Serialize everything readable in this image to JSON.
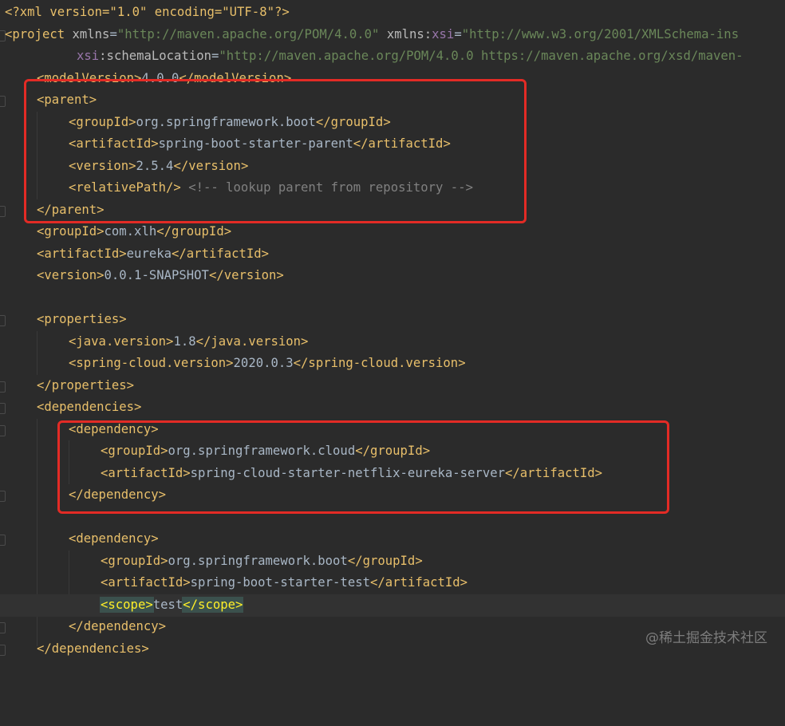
{
  "colors": {
    "background": "#2b2b2b",
    "tag": "#e8bf6a",
    "attribute": "#bababa",
    "namespace": "#9876aa",
    "string": "#6a8759",
    "text": "#a9b7c6",
    "comment": "#808080",
    "highlight_box": "#e32b25"
  },
  "lines": {
    "l1": {
      "decl": "<?xml version=\"1.0\" encoding=\"UTF-8\"?>"
    },
    "l2": {
      "open": "<project",
      "a1": " xmlns",
      "eq1": "=",
      "v1": "\"http://maven.apache.org/POM/4.0.0\"",
      "a2": " xmlns:",
      "ns2": "xsi",
      "eq2": "=",
      "v2": "\"http://www.w3.org/2001/XMLSchema-ins"
    },
    "l3": {
      "ns": "xsi",
      "a": ":schemaLocation",
      "eq": "=",
      "v": "\"http://maven.apache.org/POM/4.0.0 https://maven.apache.org/xsd/maven-"
    },
    "l4": {
      "open": "<modelVersion>",
      "text": "4.0.0",
      "close": "</modelVersion>"
    },
    "l5": {
      "open": "<parent>"
    },
    "l6": {
      "open": "<groupId>",
      "text": "org.springframework.boot",
      "close": "</groupId>"
    },
    "l7": {
      "open": "<artifactId>",
      "text": "spring-boot-starter-parent",
      "close": "</artifactId>"
    },
    "l8": {
      "open": "<version>",
      "text": "2.5.4",
      "close": "</version>"
    },
    "l9": {
      "open": "<relativePath/>",
      "comment": " <!-- lookup parent from repository -->"
    },
    "l10": {
      "close": "</parent>"
    },
    "l11": {
      "open": "<groupId>",
      "text": "com.xlh",
      "close": "</groupId>"
    },
    "l12": {
      "open": "<artifactId>",
      "text": "eureka",
      "close": "</artifactId>"
    },
    "l13": {
      "open": "<version>",
      "text": "0.0.1-SNAPSHOT",
      "close": "</version>"
    },
    "l15": {
      "open": "<properties>"
    },
    "l16": {
      "open": "<java.version>",
      "text": "1.8",
      "close": "</java.version>"
    },
    "l17": {
      "open": "<spring-cloud.version>",
      "text": "2020.0.3",
      "close": "</spring-cloud.version>"
    },
    "l18": {
      "close": "</properties>"
    },
    "l19": {
      "open": "<dependencies>"
    },
    "l20": {
      "open": "<dependency>"
    },
    "l21": {
      "open": "<groupId>",
      "text": "org.springframework.cloud",
      "close": "</groupId>"
    },
    "l22": {
      "open": "<artifactId>",
      "text": "spring-cloud-starter-netflix-eureka-server",
      "close": "</artifactId>"
    },
    "l23": {
      "close": "</dependency>"
    },
    "l25": {
      "open": "<dependency>"
    },
    "l26": {
      "open": "<groupId>",
      "text": "org.springframework.boot",
      "close": "</groupId>"
    },
    "l27": {
      "open": "<artifactId>",
      "text": "spring-boot-starter-test",
      "close": "</artifactId>"
    },
    "l28": {
      "open": "<scope>",
      "text": "test",
      "close": "</scope>"
    },
    "l29": {
      "close": "</dependency>"
    },
    "l30": {
      "close": "</dependencies>"
    }
  },
  "watermark": "@稀土掘金技术社区"
}
